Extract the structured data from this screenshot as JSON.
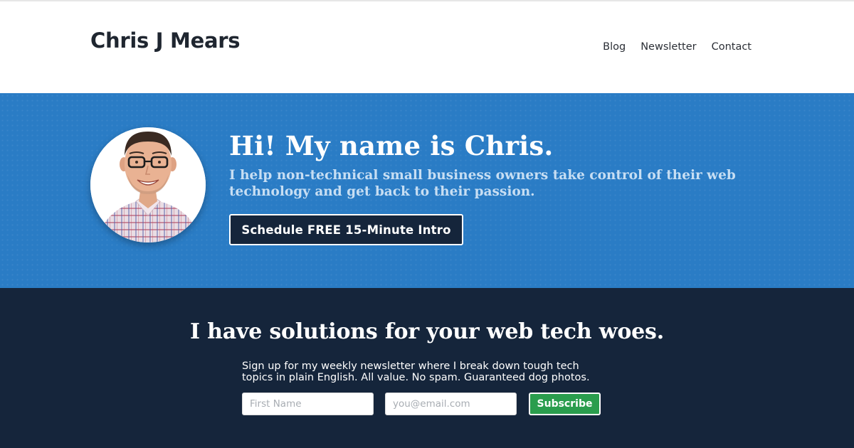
{
  "header": {
    "site_title": "Chris J Mears",
    "nav": [
      "Blog",
      "Newsletter",
      "Contact"
    ]
  },
  "hero": {
    "title": "Hi! My name is Chris.",
    "subtitle": "I help non-technical small business owners take control of their web technology and get back to their passion.",
    "cta_label": "Schedule FREE 15-Minute Intro"
  },
  "newsletter": {
    "title": "I have solutions for your web tech woes.",
    "body": "Sign up for my weekly newsletter where I break down tough tech topics in plain English. All value. No spam. Guaranteed dog photos.",
    "first_name_placeholder": "First Name",
    "email_placeholder": "you@email.com",
    "subscribe_label": "Subscribe"
  },
  "colors": {
    "hero_blue": "#2a7cc5",
    "navy": "#15253b",
    "subscribe_green": "#2a9d4d",
    "subtitle_light_blue": "#c7def3"
  },
  "icons": {
    "avatar": "portrait-photo"
  }
}
